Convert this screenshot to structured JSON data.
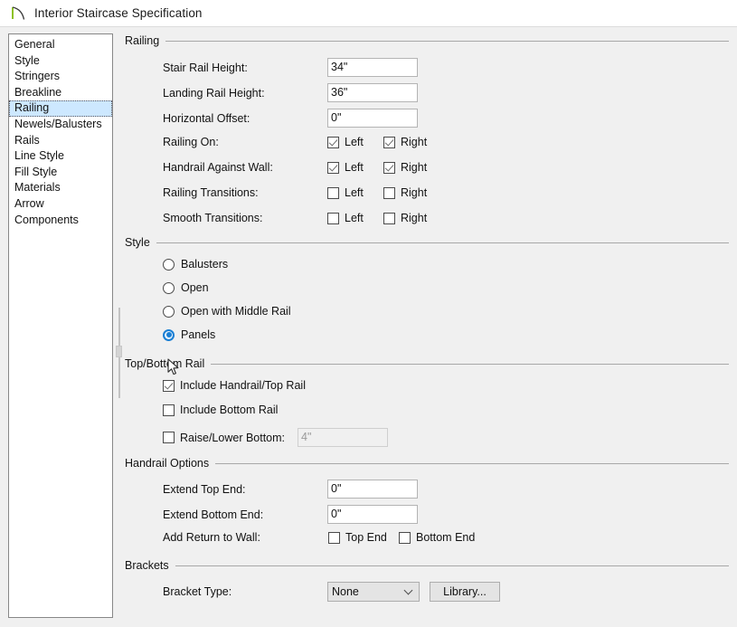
{
  "window": {
    "title": "Interior Staircase Specification",
    "icon": "staircase-curve-icon",
    "icon_accent": "#7ab800"
  },
  "sidebar": {
    "items": [
      {
        "label": "General",
        "selected": false
      },
      {
        "label": "Style",
        "selected": false
      },
      {
        "label": "Stringers",
        "selected": false
      },
      {
        "label": "Breakline",
        "selected": false
      },
      {
        "label": "Railing",
        "selected": true
      },
      {
        "label": "Newels/Balusters",
        "selected": false
      },
      {
        "label": "Rails",
        "selected": false
      },
      {
        "label": "Line Style",
        "selected": false
      },
      {
        "label": "Fill Style",
        "selected": false
      },
      {
        "label": "Materials",
        "selected": false
      },
      {
        "label": "Arrow",
        "selected": false
      },
      {
        "label": "Components",
        "selected": false
      }
    ]
  },
  "groups": {
    "railing": {
      "title": "Railing",
      "fields": {
        "stair_rail_height": {
          "label": "Stair Rail Height:",
          "value": "34\""
        },
        "landing_rail_height": {
          "label": "Landing Rail Height:",
          "value": "36\""
        },
        "horizontal_offset": {
          "label": "Horizontal Offset:",
          "value": "0\""
        }
      },
      "toggles": [
        {
          "label": "Railing On:",
          "left_label": "Left",
          "left_checked": true,
          "right_label": "Right",
          "right_checked": true
        },
        {
          "label": "Handrail Against Wall:",
          "left_label": "Left",
          "left_checked": true,
          "right_label": "Right",
          "right_checked": true
        },
        {
          "label": "Railing Transitions:",
          "left_label": "Left",
          "left_checked": false,
          "right_label": "Right",
          "right_checked": false
        },
        {
          "label": "Smooth Transitions:",
          "left_label": "Left",
          "left_checked": false,
          "right_label": "Right",
          "right_checked": false
        }
      ]
    },
    "style": {
      "title": "Style",
      "options": [
        {
          "label": "Balusters",
          "selected": false
        },
        {
          "label": "Open",
          "selected": false
        },
        {
          "label": "Open with Middle Rail",
          "selected": false
        },
        {
          "label": "Panels",
          "selected": true
        }
      ],
      "accent": "#1a7fd4"
    },
    "top_bottom_rail": {
      "title": "Top/Bottom Rail",
      "options": [
        {
          "label": "Include Handrail/Top Rail",
          "checked": true
        },
        {
          "label": "Include Bottom Rail",
          "checked": false
        }
      ],
      "raise_lower": {
        "label": "Raise/Lower Bottom:",
        "checked": false,
        "value": "4\"",
        "disabled": true
      }
    },
    "handrail_options": {
      "title": "Handrail Options",
      "fields": {
        "extend_top_end": {
          "label": "Extend Top End:",
          "value": "0\""
        },
        "extend_bottom_end": {
          "label": "Extend Bottom End:",
          "value": "0\""
        }
      },
      "add_return": {
        "label": "Add Return to Wall:",
        "top": {
          "label": "Top End",
          "checked": false
        },
        "bottom": {
          "label": "Bottom End",
          "checked": false
        }
      }
    },
    "brackets": {
      "title": "Brackets",
      "bracket_type": {
        "label": "Bracket Type:",
        "value": "None",
        "options": [
          "None"
        ]
      },
      "library_button": "Library..."
    }
  },
  "cursor": {
    "icon": "arrow-pointer-cursor"
  }
}
